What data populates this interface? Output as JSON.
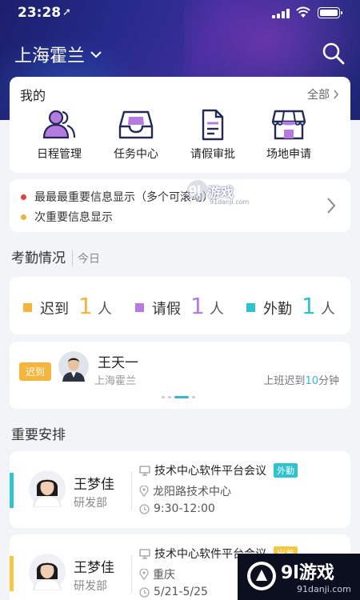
{
  "status_bar": {
    "time": "23:28",
    "location_glyph": "➚"
  },
  "header": {
    "city": "上海霍兰"
  },
  "mine": {
    "title": "我的",
    "all_label": "全部",
    "shortcuts": [
      {
        "label": "日程管理",
        "icon": "people-icon"
      },
      {
        "label": "任务中心",
        "icon": "inbox-tray-icon"
      },
      {
        "label": "请假审批",
        "icon": "document-icon"
      },
      {
        "label": "场地申请",
        "icon": "storefront-icon"
      }
    ]
  },
  "notice": {
    "items": [
      {
        "text": "最最最重要信息显示（多个可滚动）",
        "color": "#e64040"
      },
      {
        "text": "次重要信息显示",
        "color": "#f2b23a"
      }
    ]
  },
  "attendance": {
    "title": "考勤情况",
    "sub": "今日",
    "stats": [
      {
        "label": "迟到",
        "count": "1",
        "unit": "人",
        "color": "#f5b53d"
      },
      {
        "label": "请假",
        "count": "1",
        "unit": "人",
        "color": "#b57be0"
      },
      {
        "label": "外勤",
        "count": "1",
        "unit": "人",
        "color": "#2dc3cf"
      }
    ],
    "late_card": {
      "tag": "迟到",
      "name": "王天一",
      "org": "上海霍兰",
      "desc_prefix": "上班迟到",
      "desc_value": "10",
      "desc_suffix": "分钟"
    }
  },
  "schedule": {
    "title": "重要安排",
    "items": [
      {
        "name": "王梦佳",
        "dept": "研发部",
        "meeting": "技术中心软件平台会议",
        "badge": "外勤",
        "badge_color": "#2dc3cf",
        "bar_color": "#2dc3cf",
        "place": "龙阳路技术中心",
        "time": "9:30-12:00"
      },
      {
        "name": "王梦佳",
        "dept": "研发部",
        "meeting": "技术中心软件平台会议",
        "badge": "出差",
        "badge_color": "#f5c842",
        "bar_color": "#f5c842",
        "place": "重庆",
        "time": "5/21-5/25"
      }
    ]
  },
  "watermarks": {
    "top_brand": "游戏",
    "top_url": "91danji.com",
    "bottom_brand": "9l游戏",
    "bottom_url": "91danji.com"
  }
}
